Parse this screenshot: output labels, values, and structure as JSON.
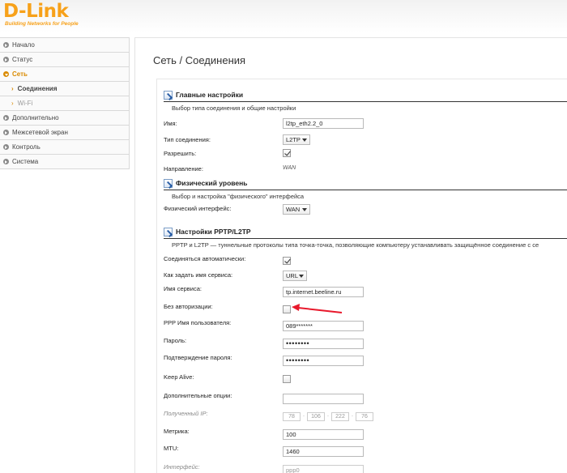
{
  "brand": {
    "logo": "D-Link",
    "tagline": "Building Networks for People"
  },
  "sidebar": {
    "items": [
      {
        "label": "Начало"
      },
      {
        "label": "Статус"
      },
      {
        "label": "Сеть"
      },
      {
        "label": "Соединения"
      },
      {
        "label": "Wi-Fi"
      },
      {
        "label": "Дополнительно"
      },
      {
        "label": "Межсетевой экран"
      },
      {
        "label": "Контроль"
      },
      {
        "label": "Система"
      }
    ]
  },
  "page": {
    "title": "Сеть / Соединения"
  },
  "sections": {
    "main": {
      "title": "Главные настройки",
      "description": "Выбор типа соединения и общие настройки",
      "name_label": "Имя:",
      "name_value": "l2tp_eth2.2_0",
      "type_label": "Тип соединения:",
      "type_value": "L2TP",
      "enable_label": "Разрешить:",
      "enable_checked": true,
      "direction_label": "Направление:",
      "direction_value": "WAN"
    },
    "physical": {
      "title": "Физический уровень",
      "description": "Выбор и настройка \"физического\" интерфейса",
      "iface_label": "Физический интерфейс:",
      "iface_value": "WAN"
    },
    "pptp": {
      "title": "Настройки PPTP/L2TP",
      "description": "PPTP и L2TP — туннельные протоколы типа точка-точка, позволяющие компьютеру устанавливать защищённое соединение с се",
      "auto_label": "Соединяться автоматически:",
      "auto_checked": true,
      "service_mode_label": "Как задать имя сервиса:",
      "service_mode_value": "URL",
      "service_name_label": "Имя сервиса:",
      "service_name_value": "tp.internet.beeline.ru",
      "no_auth_label": "Без авторизации:",
      "no_auth_checked": false,
      "ppp_user_label": "PPP Имя пользователя:",
      "ppp_user_value": "089*******",
      "password_label": "Пароль:",
      "password_value": "••••••••",
      "password_confirm_label": "Подтверждение пароля:",
      "password_confirm_value": "••••••••",
      "keepalive_label": "Keep Alive:",
      "keepalive_checked": false,
      "extra_label": "Дополнительные опции:",
      "extra_value": "",
      "received_ip_label": "Полученный IP:",
      "received_ip": [
        "78",
        "106",
        "222",
        "76"
      ],
      "metric_label": "Метрика:",
      "metric_value": "100",
      "mtu_label": "MTU:",
      "mtu_value": "1460",
      "interface_label": "Интерфейс:",
      "interface_value": "ppp0"
    }
  },
  "colors": {
    "brand": "#f7a11a",
    "active_nav": "#d98a00",
    "annotation_arrow": "#e8192c"
  }
}
